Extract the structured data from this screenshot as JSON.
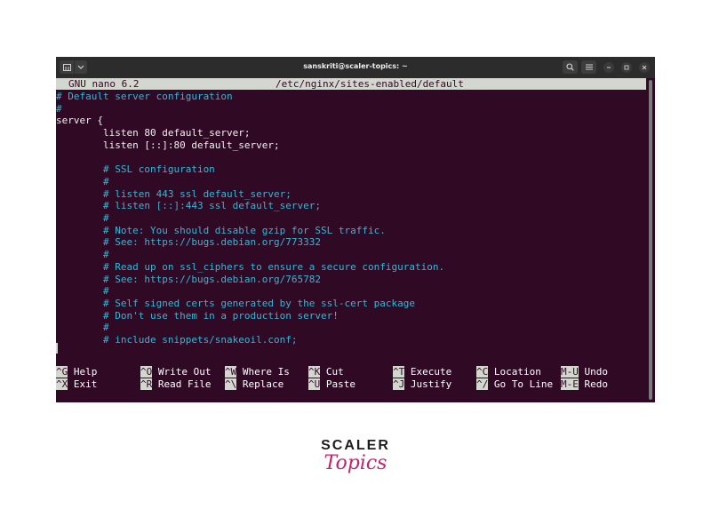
{
  "window": {
    "title": "sanskriti@scaler-topics: ~",
    "icons": [
      "terminal-tab-icon",
      "chevron-down-icon",
      "search-icon",
      "menu-icon",
      "minimize-icon",
      "maximize-icon",
      "close-icon"
    ]
  },
  "nano": {
    "version": "GNU nano 6.2",
    "filename": "/etc/nginx/sites-enabled/default",
    "lines": [
      {
        "text": "# Default server configuration",
        "style": "comment"
      },
      {
        "text": "#",
        "style": "comment"
      },
      {
        "text": "server {",
        "style": "code"
      },
      {
        "text": "        listen 80 default_server;",
        "style": "code"
      },
      {
        "text": "        listen [::]:80 default_server;",
        "style": "code"
      },
      {
        "text": "",
        "style": "code"
      },
      {
        "text": "        # SSL configuration",
        "style": "comment"
      },
      {
        "text": "        #",
        "style": "comment"
      },
      {
        "text": "        # listen 443 ssl default_server;",
        "style": "comment"
      },
      {
        "text": "        # listen [::]:443 ssl default_server;",
        "style": "comment"
      },
      {
        "text": "        #",
        "style": "comment"
      },
      {
        "text": "        # Note: You should disable gzip for SSL traffic.",
        "style": "comment"
      },
      {
        "text": "        # See: https://bugs.debian.org/773332",
        "style": "comment"
      },
      {
        "text": "        #",
        "style": "comment"
      },
      {
        "text": "        # Read up on ssl_ciphers to ensure a secure configuration.",
        "style": "comment"
      },
      {
        "text": "        # See: https://bugs.debian.org/765782",
        "style": "comment"
      },
      {
        "text": "        #",
        "style": "comment"
      },
      {
        "text": "        # Self signed certs generated by the ssl-cert package",
        "style": "comment"
      },
      {
        "text": "        # Don't use them in a production server!",
        "style": "comment"
      },
      {
        "text": "        #",
        "style": "comment"
      },
      {
        "text": "        # include snippets/snakeoil.conf;",
        "style": "comment"
      }
    ],
    "shortcuts": [
      [
        {
          "key": "^G",
          "label": "Help"
        },
        {
          "key": "^O",
          "label": "Write Out"
        },
        {
          "key": "^W",
          "label": "Where Is"
        },
        {
          "key": "^K",
          "label": "Cut"
        },
        {
          "key": "^T",
          "label": "Execute"
        },
        {
          "key": "^C",
          "label": "Location"
        },
        {
          "key": "M-U",
          "label": "Undo"
        }
      ],
      [
        {
          "key": "^X",
          "label": "Exit"
        },
        {
          "key": "^R",
          "label": "Read File"
        },
        {
          "key": "^\\",
          "label": "Replace"
        },
        {
          "key": "^U",
          "label": "Paste"
        },
        {
          "key": "^J",
          "label": "Justify"
        },
        {
          "key": "^/",
          "label": "Go To Line"
        },
        {
          "key": "M-E",
          "label": "Redo"
        }
      ]
    ]
  },
  "branding": {
    "top": "SCALER",
    "bottom": "Topics"
  },
  "colors": {
    "terminal_bg": "#300a24",
    "comment": "#34b6d6",
    "header_bg": "#d3d7cf",
    "brand_pink": "#c8206f"
  }
}
